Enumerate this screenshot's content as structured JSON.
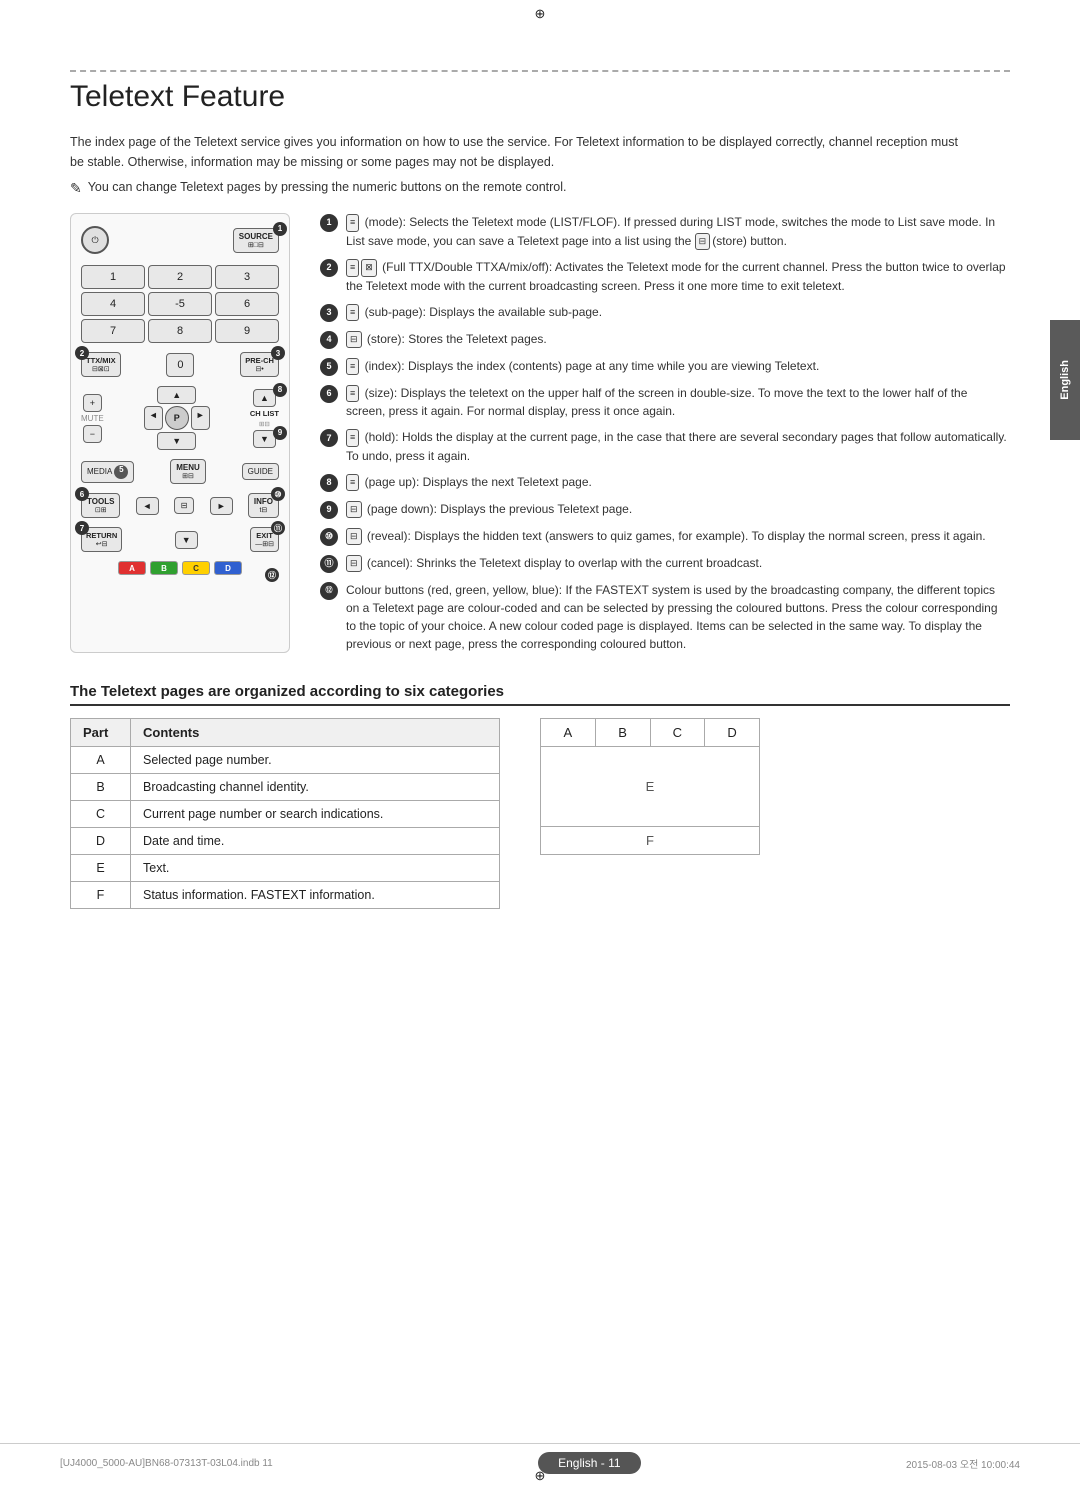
{
  "page": {
    "title": "Teletext Feature",
    "top_crosshair": "⊕",
    "bottom_crosshair": "⊕",
    "left_crosshair": "⊕",
    "right_crosshair": "⊕"
  },
  "side_tab": {
    "label": "English"
  },
  "intro": {
    "paragraph": "The index page of the Teletext service gives you information on how to use the service. For Teletext information to be displayed correctly, channel reception must be stable. Otherwise, information may be missing or some pages may not be displayed.",
    "note": "You can change Teletext pages by pressing the numeric buttons on the remote control."
  },
  "remote": {
    "source_label": "SOURCE",
    "source_sublabel": "⊞□⊟",
    "power_icon": "⏻",
    "ttx_mix_label": "TTX/MIX",
    "ttx_sub": "⊟⊠⊡",
    "pre_ch_label": "PRE-CH",
    "pre_ch_sub": "⊟•",
    "mute_label": "MUTE",
    "num_buttons": [
      "1",
      "2",
      "3",
      "4",
      "-5",
      "6",
      "7",
      "8",
      "9",
      "0"
    ],
    "ch_list_label": "CH LIST",
    "ch_list_sub": "⊞⊟",
    "media_label": "MEDIA",
    "menu_label": "MENU",
    "menu_sub": "⊞⊟",
    "guide_label": "GUIDE",
    "tools_label": "TOOLS",
    "tools_sub": "⊡⊞",
    "info_label": "INFO",
    "info_sub": "t⊟",
    "return_label": "RETURN",
    "return_sub": "↩⊟",
    "exit_label": "EXIT",
    "exit_sub": "—⊞⊟",
    "p_label": "P",
    "nav_up": "▲",
    "nav_down": "▼",
    "nav_left": "◄",
    "nav_right": "►",
    "color_buttons": [
      {
        "label": "A",
        "color": "#e03030"
      },
      {
        "label": "B",
        "color": "#30a030"
      },
      {
        "label": "C",
        "color": "#ffd000"
      },
      {
        "label": "D",
        "color": "#3060d0"
      }
    ]
  },
  "instructions": [
    {
      "num": "1",
      "icon": "≡",
      "text": "(mode): Selects the Teletext mode (LIST/FLOF). If pressed during LIST mode, switches the mode to List save mode. In List save mode, you can save a Teletext page into a list using the",
      "icon2": "⊟",
      "text2": "(store) button."
    },
    {
      "num": "2",
      "icon": "≡⊠",
      "text": "(Full TTX/Double TTXA/mix/off): Activates the Teletext mode for the current channel. Press the button twice to overlap the Teletext mode with the current broadcasting screen. Press it one more time to exit teletext."
    },
    {
      "num": "3",
      "icon": "≡",
      "text": "(sub-page): Displays the available sub-page."
    },
    {
      "num": "4",
      "icon": "⊟",
      "text": "(store): Stores the Teletext pages."
    },
    {
      "num": "5",
      "icon": "≡",
      "text": "(index): Displays the index (contents) page at any time while you are viewing Teletext."
    },
    {
      "num": "6",
      "icon": "≡",
      "text": "(size): Displays the teletext on the upper half of the screen in double-size. To move the text to the lower half of the screen, press it again. For normal display, press it once again."
    },
    {
      "num": "7",
      "icon": "≡",
      "text": "(hold): Holds the display at the current page, in the case that there are several secondary pages that follow automatically. To undo, press it again."
    },
    {
      "num": "8",
      "icon": "≡",
      "text": "(page up): Displays the next Teletext page."
    },
    {
      "num": "9",
      "icon": "⊟",
      "text": "(page down): Displays the previous Teletext page."
    },
    {
      "num": "10",
      "icon": "⊟",
      "text": "(reveal): Displays the hidden text (answers to quiz games, for example). To display the normal screen, press it again."
    },
    {
      "num": "11",
      "icon": "⊟",
      "text": "(cancel): Shrinks the Teletext display to overlap with the current broadcast."
    },
    {
      "num": "12",
      "icon": "",
      "text": "Colour buttons (red, green, yellow, blue): If the FASTEXT system is used by the broadcasting company, the different topics on a Teletext page are colour-coded and can be selected by pressing the coloured buttons. Press the colour corresponding to the topic of your choice. A new colour coded page is displayed. Items can be selected in the same way. To display the previous or next page, press the corresponding coloured button."
    }
  ],
  "table_section": {
    "title": "The Teletext pages are organized according to six categories",
    "headers": [
      "Part",
      "Contents"
    ],
    "rows": [
      {
        "part": "A",
        "contents": "Selected page number."
      },
      {
        "part": "B",
        "contents": "Broadcasting channel identity."
      },
      {
        "part": "C",
        "contents": "Current page number or search indications."
      },
      {
        "part": "D",
        "contents": "Date and time."
      },
      {
        "part": "E",
        "contents": "Text."
      },
      {
        "part": "F",
        "contents": "Status information. FASTEXT information."
      }
    ],
    "diagram": {
      "top_cells": [
        "A",
        "B",
        "C",
        "D"
      ],
      "middle_label": "E",
      "bottom_label": "F"
    }
  },
  "footer": {
    "left_text": "[UJ4000_5000-AU]BN68-07313T-03L04.indb   11",
    "center_text": "English - 11",
    "right_text": "2015-08-03   오전 10:00:44"
  }
}
